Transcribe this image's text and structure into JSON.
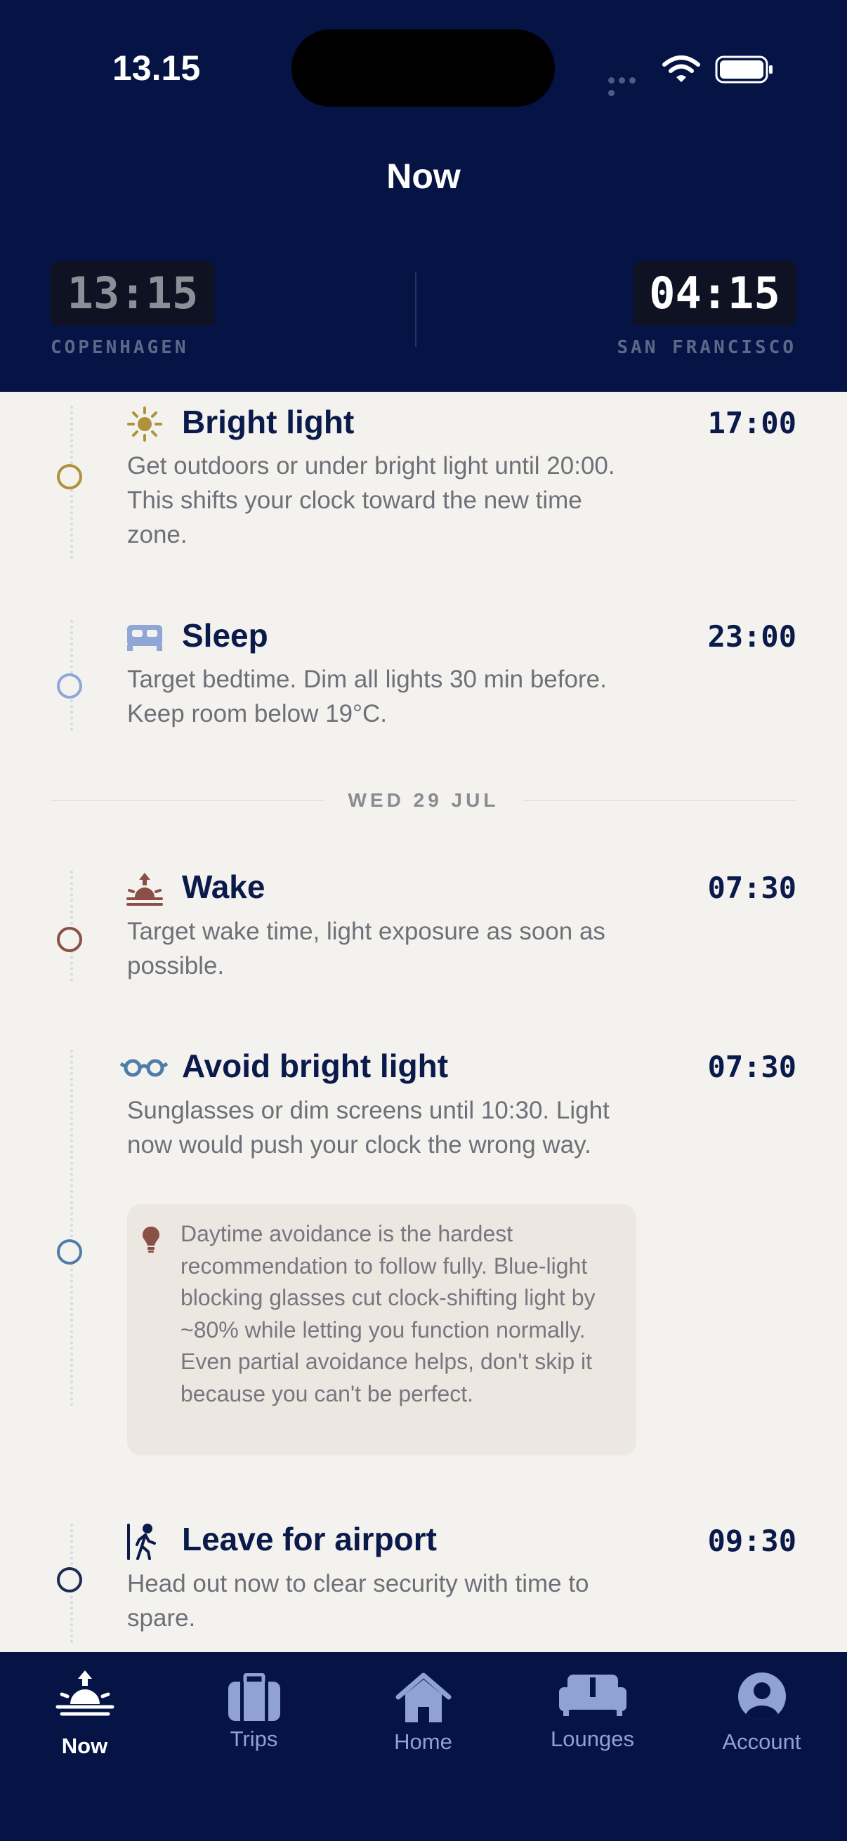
{
  "status_bar": {
    "time": "13.15"
  },
  "header": {
    "title": "Now",
    "clocks": [
      {
        "time": "13:15",
        "city": "COPENHAGEN"
      },
      {
        "time": "04:15",
        "city": "SAN FRANCISCO"
      }
    ]
  },
  "events": [
    {
      "icon": "sun-icon",
      "title": "Bright light",
      "time": "17:00",
      "description": "Get outdoors or under bright light until 20:00. This shifts your clock toward the new time zone.",
      "color": "#B0913C"
    },
    {
      "icon": "bed-icon",
      "title": "Sleep",
      "time": "23:00",
      "description": "Target bedtime. Dim all lights 30 min before. Keep room below 19°C.",
      "color": "#8FA7D6"
    },
    {
      "icon": "sunrise-icon",
      "title": "Wake",
      "time": "07:30",
      "description": "Target wake time, light exposure as soon as possible.",
      "color": "#8A4F45"
    },
    {
      "icon": "glasses-icon",
      "title": "Avoid bright light",
      "time": "07:30",
      "description": "Sunglasses or dim screens until 10:30. Light now would push your clock the wrong way.",
      "color": "#4F7DA8",
      "tip": "Daytime avoidance is the hardest recommendation to follow fully. Blue-light blocking glasses cut clock-shifting light by ~80% while letting you function normally. Even partial avoidance helps, don't skip it because you can't be perfect."
    },
    {
      "icon": "walking-icon",
      "title": "Leave for airport",
      "time": "09:30",
      "description": "Head out now to clear security with time to spare.",
      "color": "#1C2A55"
    }
  ],
  "day_separator": "WED 29 JUL",
  "tabs": [
    {
      "label": "Now",
      "icon": "sunrise-icon",
      "active": true
    },
    {
      "label": "Trips",
      "icon": "suitcase-icon",
      "active": false
    },
    {
      "label": "Home",
      "icon": "home-icon",
      "active": false
    },
    {
      "label": "Lounges",
      "icon": "sofa-icon",
      "active": false
    },
    {
      "label": "Account",
      "icon": "account-icon",
      "active": false
    }
  ]
}
